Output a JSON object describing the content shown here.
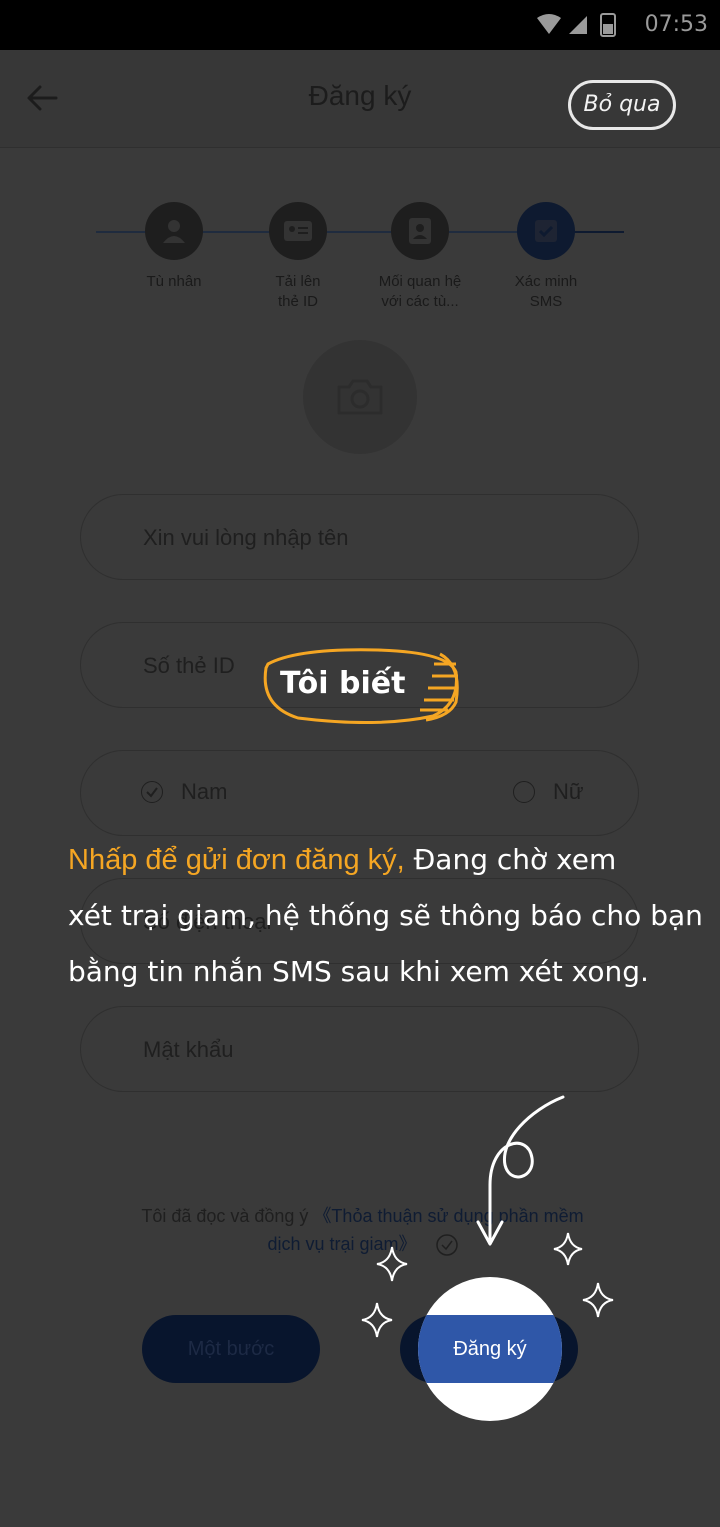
{
  "status": {
    "time": "07:53"
  },
  "header": {
    "title": "Đăng ký",
    "skip_label": "Bỏ qua"
  },
  "steps": [
    {
      "label_line1": "Tù nhân",
      "label_line2": "",
      "icon": "person-icon"
    },
    {
      "label_line1": "Tải lên",
      "label_line2": "thẻ ID",
      "icon": "id-card-icon"
    },
    {
      "label_line1": "Mối quan hệ",
      "label_line2": "với các tù...",
      "icon": "contact-icon"
    },
    {
      "label_line1": "Xác minh",
      "label_line2": "SMS",
      "icon": "check-icon"
    }
  ],
  "form": {
    "name_placeholder": "Xin vui lòng nhập tên",
    "id_placeholder": "Số thẻ ID",
    "gender_male": "Nam",
    "gender_female": "Nữ",
    "phone_placeholder": "Số điện thoại",
    "password_placeholder": "Mật khẩu"
  },
  "terms": {
    "prefix": "Tôi đã đọc và đồng ý ",
    "link_part1": "《Thỏa thuận sử dụng phần mềm",
    "link_part2": "dịch vụ trại giam》"
  },
  "buttons": {
    "previous_label": "Một bước",
    "register_label": "Đăng ký"
  },
  "guide": {
    "dismiss_label": "Tôi biết",
    "highlight": "Nhấp để gửi đơn đăng ký,",
    "line1_rest": "  Đang chờ xem",
    "line2": "xét trại giam, hệ thống sẽ thông báo cho bạn",
    "line3": " bằng tin nhắn SMS sau khi xem xét xong."
  },
  "colors": {
    "accent": "#2f57a8",
    "highlight": "#f5a623",
    "overlay": "#3a3a3a"
  }
}
